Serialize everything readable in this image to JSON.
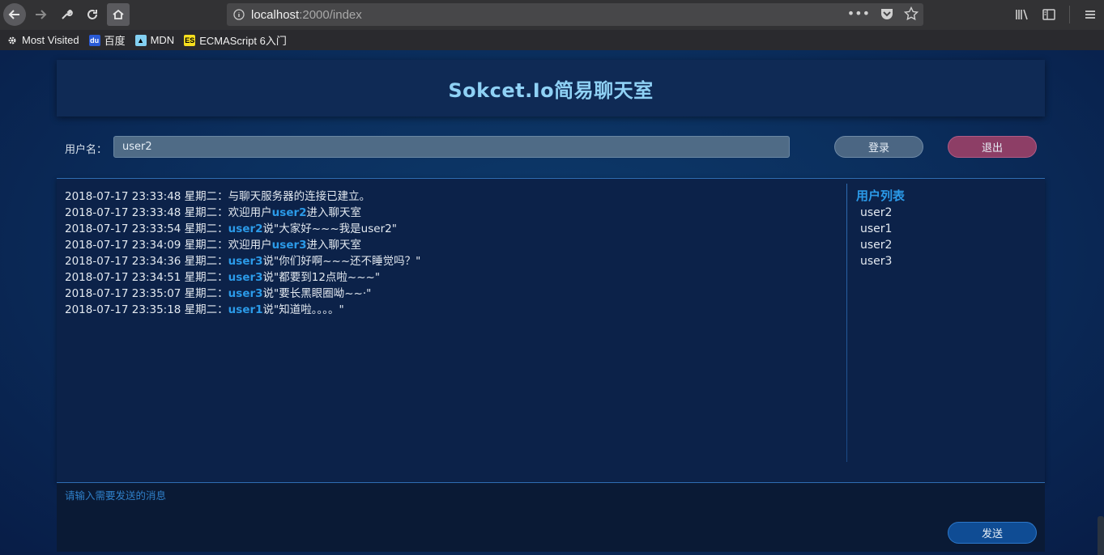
{
  "browser": {
    "url_host": "localhost",
    "url_path": ":2000/index",
    "bookmarks": [
      "Most Visited",
      "百度",
      "MDN",
      "ECMAScript 6入门"
    ]
  },
  "header": {
    "title": "Sokcet.Io简易聊天室"
  },
  "login": {
    "label": "用户名：",
    "username_value": "user2",
    "login_button": "登录",
    "logout_button": "退出"
  },
  "messages": [
    {
      "time": "2018-07-17 23:33:48 星期二：",
      "user": "",
      "text": "与聊天服务器的连接已建立。"
    },
    {
      "time": "2018-07-17 23:33:48 星期二：",
      "pre": "欢迎用户",
      "user": "user2",
      "text": "进入聊天室"
    },
    {
      "time": "2018-07-17 23:33:54 星期二：",
      "user": "user2",
      "text": "说\"大家好~~~我是user2\""
    },
    {
      "time": "2018-07-17 23:34:09 星期二：",
      "pre": "欢迎用户",
      "user": "user3",
      "text": "进入聊天室"
    },
    {
      "time": "2018-07-17 23:34:36 星期二：",
      "user": "user3",
      "text": "说\"你们好啊~~~还不睡觉吗？\""
    },
    {
      "time": "2018-07-17 23:34:51 星期二：",
      "user": "user3",
      "text": "说\"都要到12点啦~~~\""
    },
    {
      "time": "2018-07-17 23:35:07 星期二：",
      "user": "user3",
      "text": "说\"要长黑眼圈呦~~·\""
    },
    {
      "time": "2018-07-17 23:35:18 星期二：",
      "user": "user1",
      "text": "说\"知道啦。。。。\""
    }
  ],
  "userlist": {
    "title": "用户列表",
    "users": [
      "user2",
      "user1",
      "user2",
      "user3"
    ]
  },
  "composer": {
    "placeholder": "请输入需要发送的消息",
    "send_button": "发送"
  },
  "colors": {
    "accent": "#2b9ae8",
    "title": "#8fd1f5",
    "logout": "#8d3e66",
    "send": "#0f4c94"
  }
}
